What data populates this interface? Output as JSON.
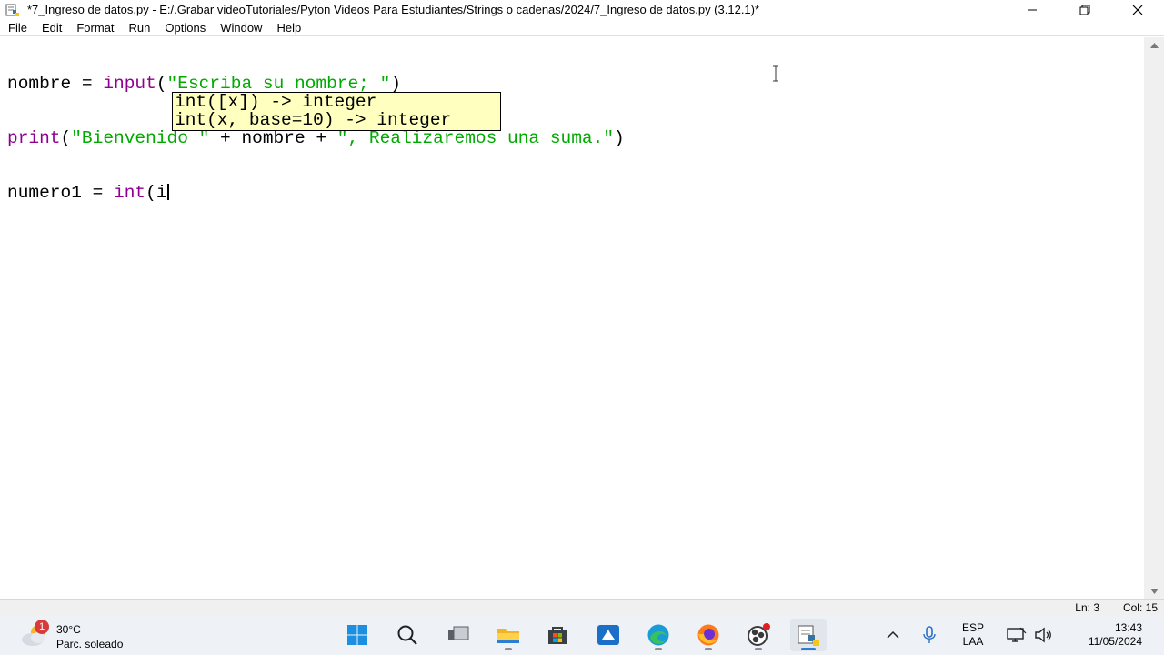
{
  "window": {
    "title": "*7_Ingreso de datos.py - E:/.Grabar videoTutoriales/Pyton Videos Para Estudiantes/Strings o cadenas/2024/7_Ingreso de datos.py (3.12.1)*",
    "app_icon": "python-idle-icon",
    "controls": [
      "minimize-icon",
      "restore-icon",
      "close-icon"
    ]
  },
  "menu": {
    "file": "File",
    "edit": "Edit",
    "format": "Format",
    "run": "Run",
    "options": "Options",
    "window": "Window",
    "help": "Help"
  },
  "editor": {
    "line1": {
      "a": "nombre = ",
      "b": "input",
      "c": "(",
      "d": "\"Escriba su nombre; \"",
      "e": ")"
    },
    "line2": {
      "a": "print",
      "b": "(",
      "c": "\"Bienvenido \"",
      "d": " + nombre + ",
      "e": "\", Realizaremos una suma.\"",
      "f": ")"
    },
    "line3": {
      "a": "numero1 = ",
      "b": "int",
      "c": "(i"
    },
    "calltip": {
      "line1": "int([x]) -> integer",
      "line2": "int(x, base=10) -> integer"
    },
    "colors": {
      "keyword": "#900090",
      "string": "#00aa00",
      "calltip_bg": "#ffffc0"
    }
  },
  "statusbar": {
    "ln": "Ln: 3",
    "col": "Col: 15"
  },
  "taskbar": {
    "weather": {
      "badge": "1",
      "temp": "30°C",
      "desc": "Parc. soleado"
    },
    "apps": [
      "windows-start-icon",
      "search-icon",
      "task-view-icon",
      "file-explorer-icon",
      "microsoft-store-icon",
      "vscode-like-icon",
      "edge-icon",
      "firefox-icon",
      "obs-icon",
      "python-idle-icon"
    ],
    "tray": {
      "lang_line1": "ESP",
      "lang_line2": "LAA",
      "time": "13:43",
      "date": "11/05/2024"
    }
  }
}
